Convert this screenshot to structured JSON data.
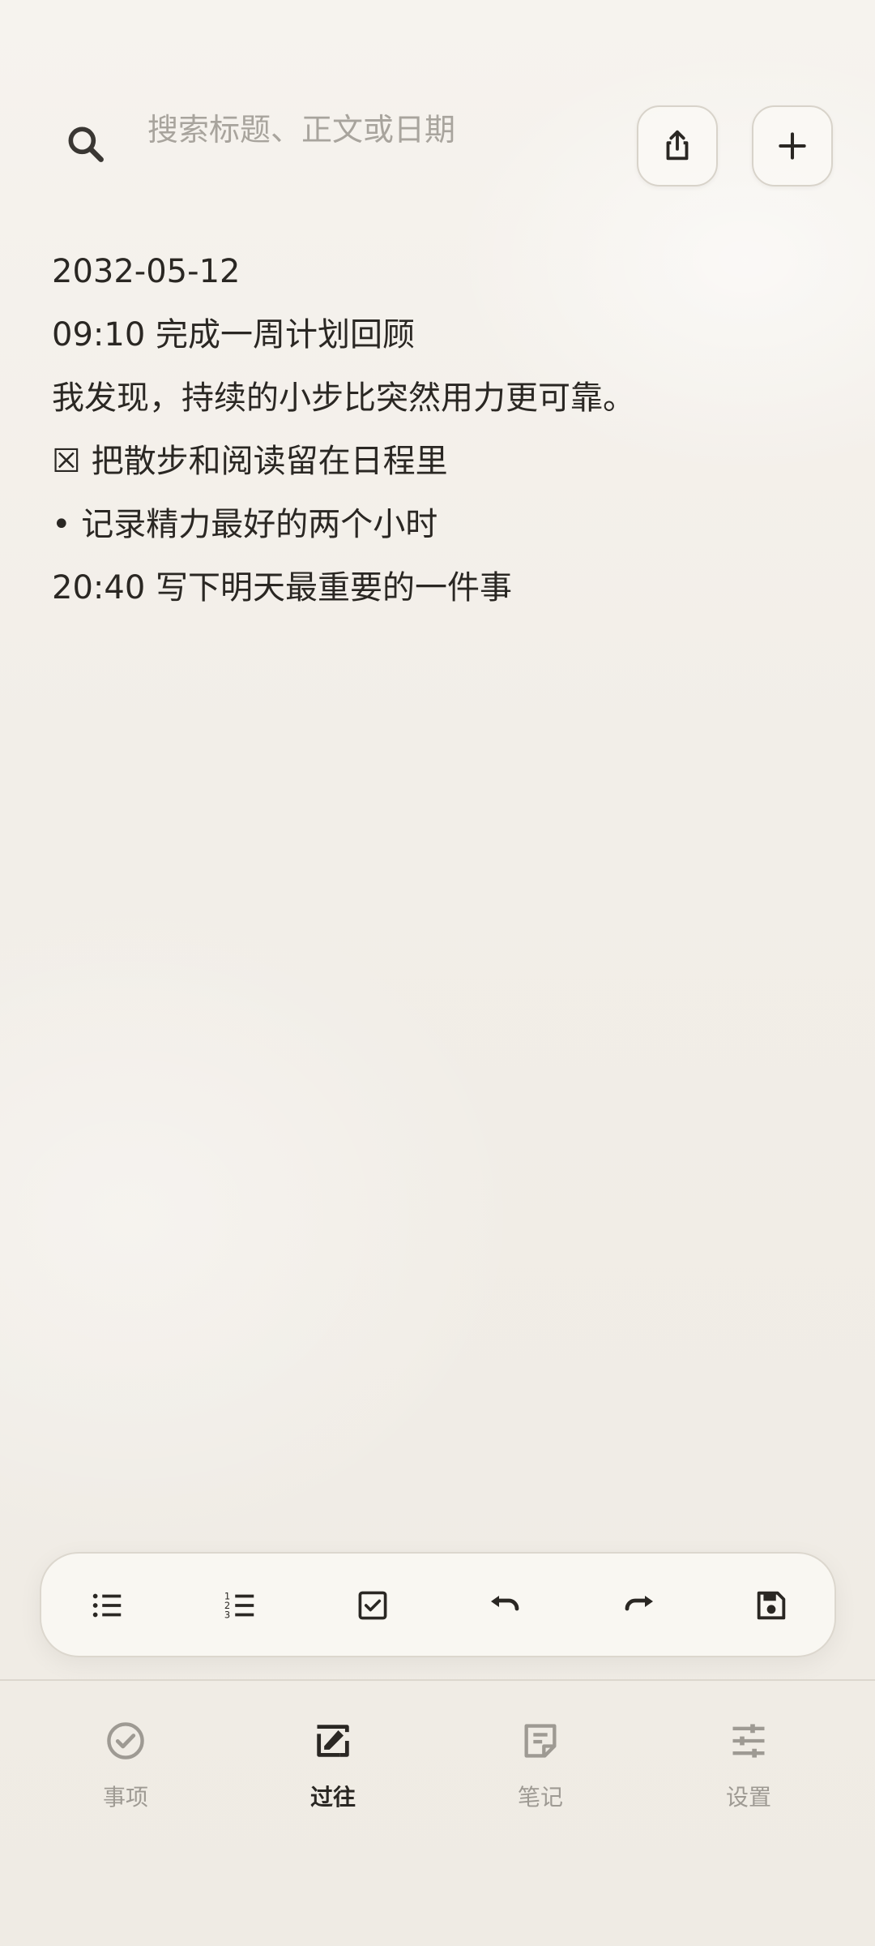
{
  "search": {
    "placeholder": "搜索标题、正文或日期"
  },
  "header": {
    "share_icon": "share-icon",
    "add_icon": "plus-icon"
  },
  "note": {
    "lines": [
      "2032-05-12",
      "09:10  完成一周计划回顾",
      "我发现，持续的小步比突然用力更可靠。",
      "☒ 把散步和阅读留在日程里",
      "• 记录精力最好的两个小时",
      "20:40  写下明天最重要的一件事"
    ]
  },
  "toolbar": {
    "tools": [
      "bullet-list-icon",
      "numbered-list-icon",
      "checkbox-icon",
      "undo-icon",
      "redo-icon",
      "save-icon"
    ]
  },
  "nav": {
    "items": [
      {
        "label": "事项",
        "icon": "check-circle-icon",
        "active": false
      },
      {
        "label": "过往",
        "icon": "history-edit-icon",
        "active": true
      },
      {
        "label": "笔记",
        "icon": "note-icon",
        "active": false
      },
      {
        "label": "设置",
        "icon": "sliders-icon",
        "active": false
      }
    ]
  },
  "colors": {
    "background": "#f3efe9",
    "text": "#2a2723",
    "muted": "#9e9a93",
    "border": "#dcd7ce"
  }
}
